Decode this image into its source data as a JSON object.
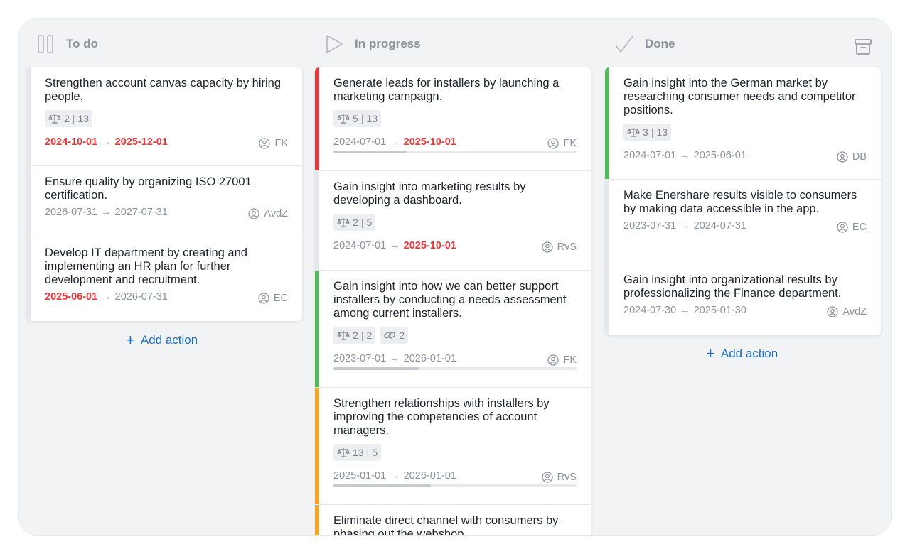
{
  "columns": [
    {
      "title": "To do",
      "icon": "pause-icon",
      "add_label": "Add action",
      "cards": [
        {
          "title": "Strengthen account canvas capacity by hiring people.",
          "chips": [
            {
              "type": "effort",
              "a": "2",
              "b": "13"
            }
          ],
          "start": "2024-10-01",
          "end": "2025-12-01",
          "start_late": true,
          "end_late": true,
          "owner": "FK"
        },
        {
          "title": "Ensure quality by organizing ISO 27001 certification.",
          "chips": [],
          "start": "2026-07-31",
          "end": "2027-07-31",
          "owner": "AvdZ"
        },
        {
          "title": "Develop IT department by creating and implementing an HR plan for further development and recruitment.",
          "chips": [],
          "start": "2025-06-01",
          "end": "2026-07-31",
          "start_late": true,
          "owner": "EC"
        }
      ]
    },
    {
      "title": "In progress",
      "icon": "play-icon",
      "cards": [
        {
          "title": "Generate leads for installers by launching a marketing campaign.",
          "status_color": "#e5383b",
          "chips": [
            {
              "type": "effort",
              "a": "5",
              "b": "13"
            }
          ],
          "start": "2024-07-01",
          "end": "2025-10-01",
          "end_late": true,
          "owner": "FK",
          "progress": 0.3
        },
        {
          "title": "Gain insight into marketing results by developing a dashboard.",
          "chips": [
            {
              "type": "effort",
              "a": "2",
              "b": "5"
            }
          ],
          "start": "2024-07-01",
          "end": "2025-10-01",
          "end_late": true,
          "owner": "RvS"
        },
        {
          "title": "Gain insight into how we can better support installers by conducting a needs assessment among current installers.",
          "status_color": "#55b95c",
          "chips": [
            {
              "type": "effort",
              "a": "2",
              "b": "2"
            },
            {
              "type": "link",
              "a": "2"
            }
          ],
          "start": "2023-07-01",
          "end": "2026-01-01",
          "owner": "FK",
          "progress": 0.35
        },
        {
          "title": "Strengthen relationships with installers by improving the competencies of account managers.",
          "status_color": "#f5a623",
          "chips": [
            {
              "type": "effort",
              "a": "13",
              "b": "5"
            }
          ],
          "start": "2025-01-01",
          "end": "2026-01-01",
          "owner": "RvS",
          "progress": 0.4
        },
        {
          "title": "Eliminate direct channel with consumers by phasing out the webshop.",
          "status_color": "#f5a623",
          "chips": [],
          "start": "",
          "end": "",
          "owner": ""
        }
      ]
    },
    {
      "title": "Done",
      "icon": "check-icon",
      "add_label": "Add action",
      "cards": [
        {
          "title": "Gain insight into the German market by researching consumer needs and competitor positions.",
          "status_color": "#55b95c",
          "chips": [
            {
              "type": "effort",
              "a": "3",
              "b": "13"
            }
          ],
          "start": "2024-07-01",
          "end": "2025-06-01",
          "owner": "DB"
        },
        {
          "title": "Make Enershare results visible to consumers by making data accessible in the app.",
          "chips": [],
          "start": "2023-07-31",
          "end": "2024-07-31",
          "owner": "EC"
        },
        {
          "title": "Gain insight into organizational results by professionalizing the Finance department.",
          "chips": [],
          "start": "2024-07-30",
          "end": "2025-01-30",
          "owner": "AvdZ"
        }
      ]
    }
  ]
}
